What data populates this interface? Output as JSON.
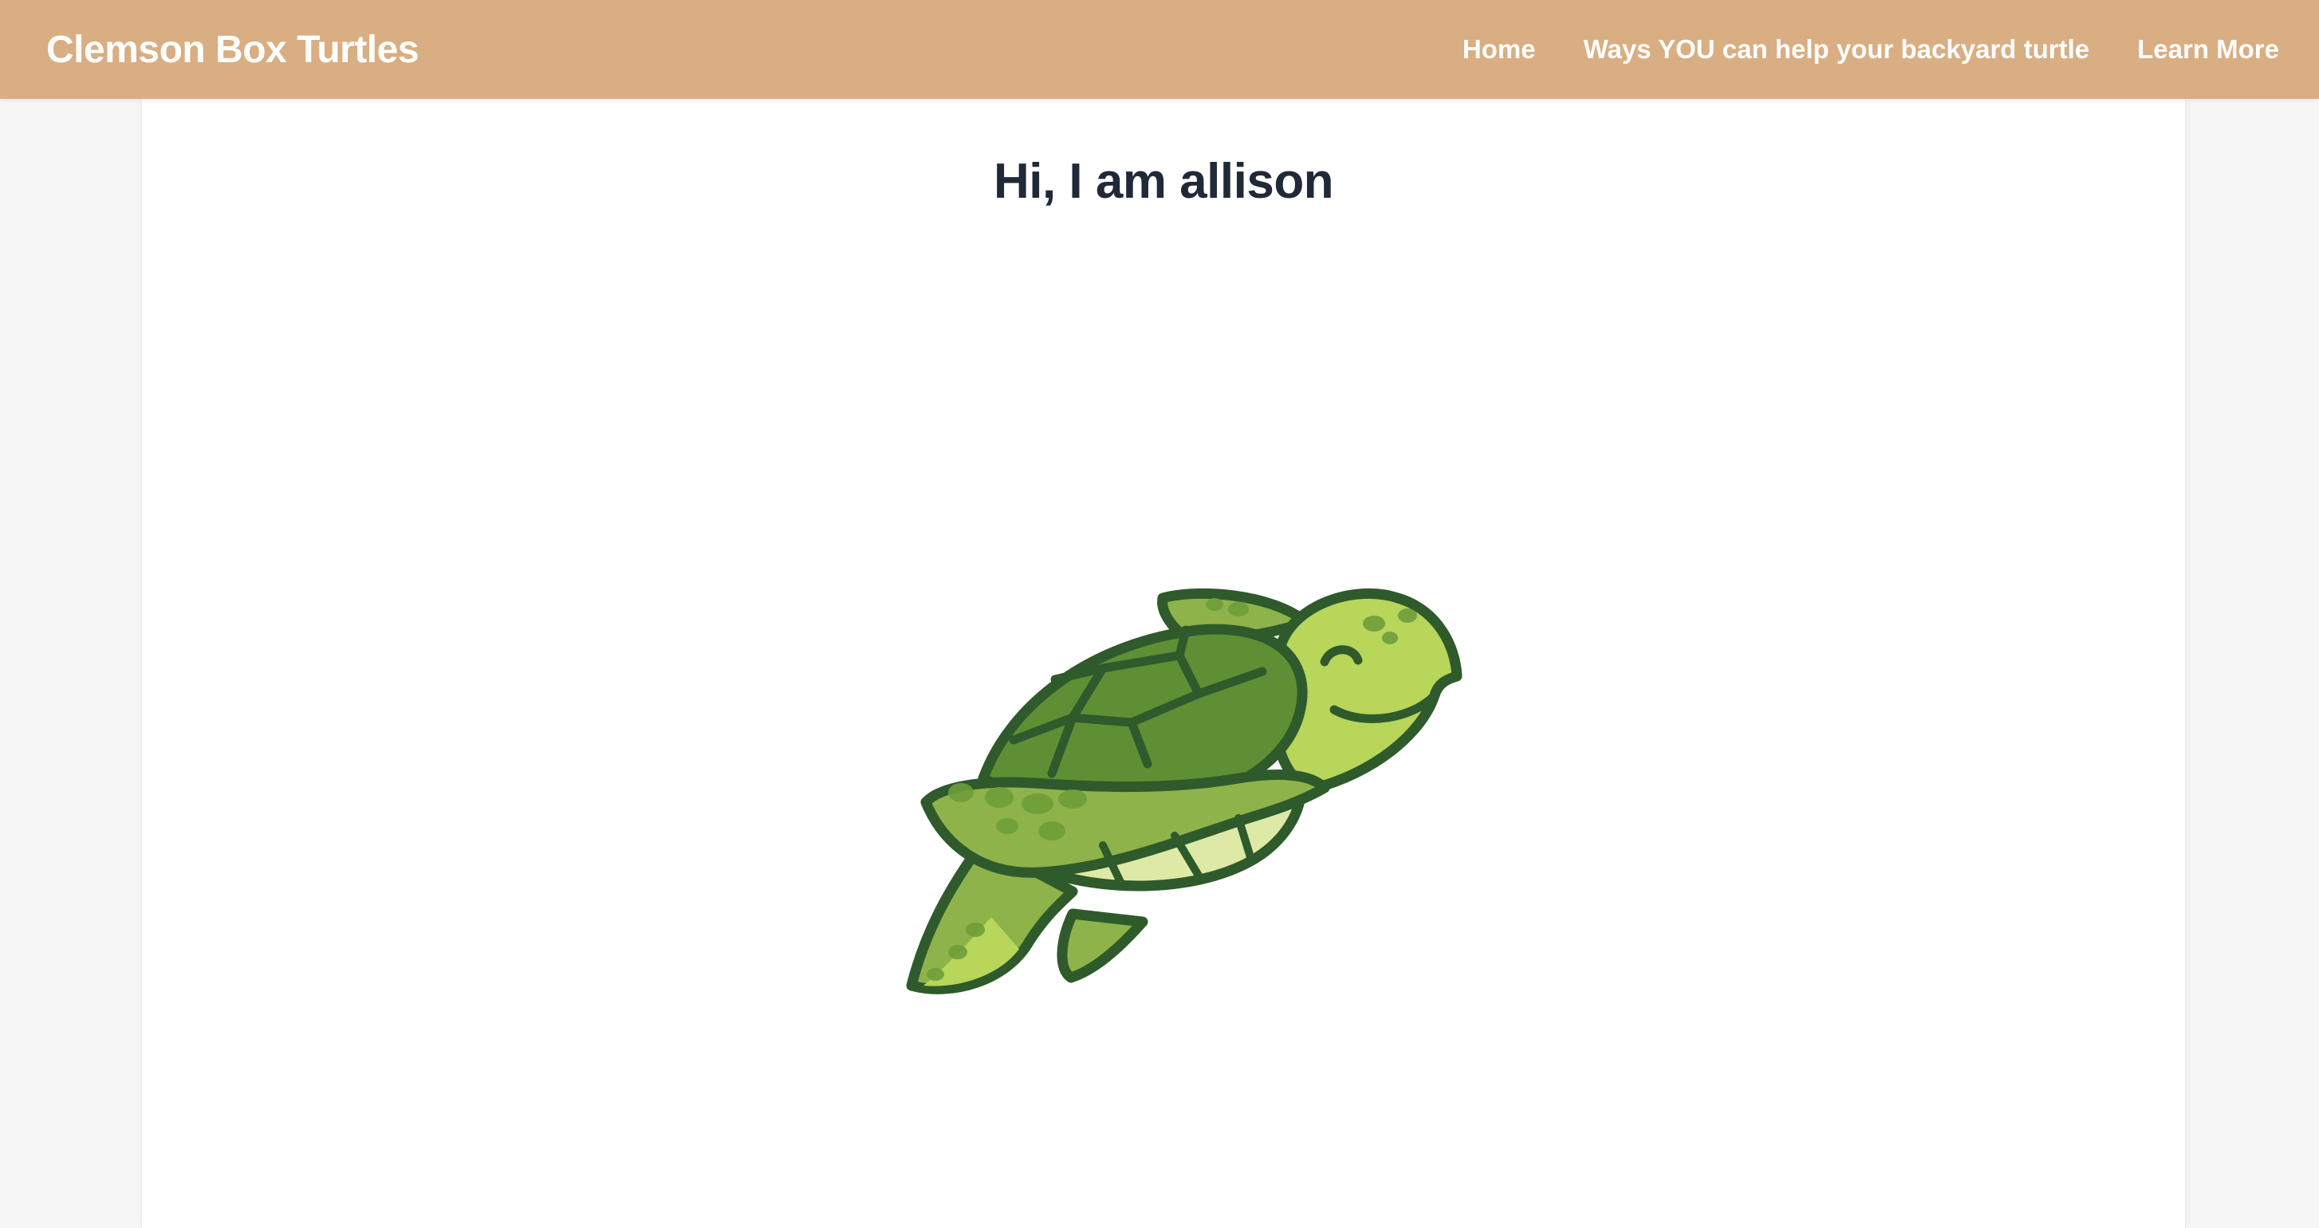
{
  "navbar": {
    "brand": "Clemson Box Turtles",
    "links": [
      {
        "label": "Home"
      },
      {
        "label": "Ways YOU can help your backyard turtle"
      },
      {
        "label": "Learn More"
      }
    ],
    "background_color": "#d9ae82",
    "text_color": "#ffffff"
  },
  "main": {
    "heading": "Hi, I am allison",
    "image": {
      "icon": "sea-turtle-illustration"
    }
  }
}
